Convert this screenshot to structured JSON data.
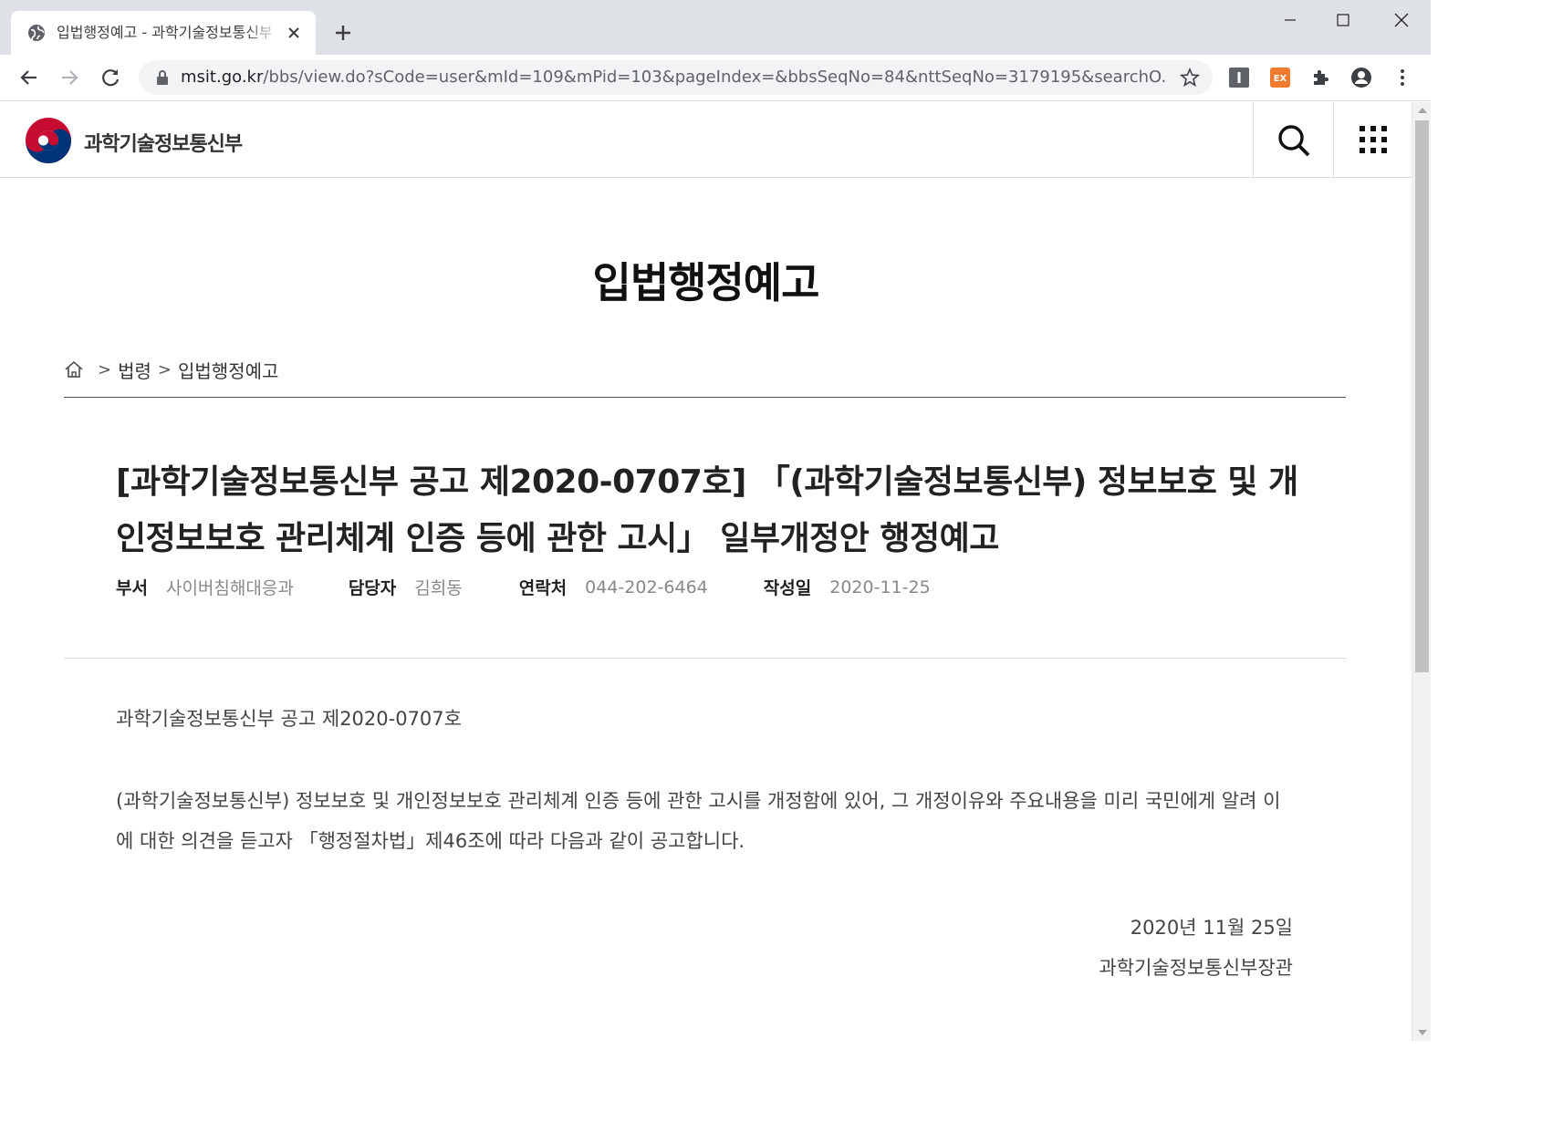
{
  "browser": {
    "tab_title": "입법행정예고 - 과학기술정보통신부",
    "url_host": "msit.go.kr",
    "url_path": "/bbs/view.do?sCode=user&mId=109&mPid=103&pageIndex=&bbsSeqNo=84&nttSeqNo=3179195&searchO...",
    "extensions": [
      "I",
      "EX"
    ]
  },
  "site": {
    "logo_text": "과학기술정보통신부"
  },
  "page": {
    "title": "입법행정예고",
    "breadcrumb": [
      "법령",
      "입법행정예고"
    ]
  },
  "post": {
    "title": "[과학기술정보통신부 공고 제2020-0707호] 「(과학기술정보통신부) 정보보호 및 개인정보보호 관리체계 인증 등에 관한 고시」 일부개정안 행정예고",
    "meta": [
      {
        "label": "부서",
        "value": "사이버침해대응과"
      },
      {
        "label": "담당자",
        "value": "김희동"
      },
      {
        "label": "연락처",
        "value": "044-202-6464"
      },
      {
        "label": "작성일",
        "value": "2020-11-25"
      }
    ],
    "notice_number": "과학기술정보통신부 공고 제2020-0707호",
    "body": "(과학기술정보통신부) 정보보호 및 개인정보보호 관리체계 인증 등에 관한 고시를 개정함에 있어, 그 개정이유와 주요내용을 미리 국민에게 알려 이에 대한 의견을 듣고자 「행정절차법」제46조에 따라 다음과 같이 공고합니다.",
    "sign_date": "2020년 11월 25일",
    "sign_org": "과학기술정보통신부장관"
  }
}
